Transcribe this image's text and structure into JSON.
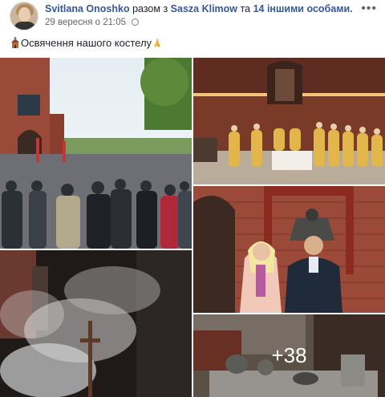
{
  "post": {
    "author": "Svitlana Onoshko",
    "with_prefix": "разом з",
    "tagged_person": "Sasza Klimow",
    "and_text": "та",
    "others": "14 іншими особами.",
    "timestamp": "29 вересня о 21:05",
    "privacy_icon": "globe-icon",
    "menu_label": "•••",
    "text": "Освячення нашого костелу"
  },
  "gallery": {
    "photos": [
      {
        "name": "church-crowd-photo",
        "icon": "photo"
      },
      {
        "name": "altar-mass-photo",
        "icon": "photo"
      },
      {
        "name": "couple-bell-photo",
        "icon": "photo"
      },
      {
        "name": "incense-cross-photo",
        "icon": "photo"
      },
      {
        "name": "vessels-photo",
        "icon": "photo"
      }
    ],
    "more_count": "+38"
  },
  "colors": {
    "author_link": "#385898",
    "text": "#1d2129",
    "meta": "#616770"
  }
}
